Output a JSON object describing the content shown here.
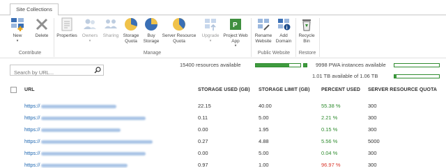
{
  "ribbon": {
    "tab": "Site Collections",
    "groups": [
      {
        "label": "Contribute"
      },
      {
        "label": "Manage"
      },
      {
        "label": "Public Website"
      },
      {
        "label": "Restore"
      }
    ],
    "buttons": {
      "new": "New",
      "delete": "Delete",
      "properties": "Properties",
      "owners": "Owners",
      "sharing": "Sharing",
      "storage_quota": "Storage Quota",
      "buy_storage": "Buy Storage",
      "server_resource_quota": "Server Resource Quota",
      "upgrade": "Upgrade",
      "project_web_app": "Project Web App",
      "rename_website": "Rename Website",
      "add_domain": "Add Domain",
      "recycle_bin": "Recycle Bin"
    }
  },
  "search": {
    "placeholder": "Search by URL..."
  },
  "resources": {
    "resources_text": "15400 resources available",
    "resources_fraction": 0.75,
    "pwa_text": "9998 PWA instances available",
    "pwa_fraction": 0.003,
    "storage_text": "1.01 TB available of 1.06 TB",
    "storage_fraction": 0.02
  },
  "table": {
    "headers": [
      "URL",
      "STORAGE USED (GB)",
      "STORAGE LIMIT (GB)",
      "PERCENT USED",
      "SERVER RESOURCE QUOTA"
    ],
    "rows": [
      {
        "url": "https://",
        "used": "22.15",
        "limit": "40.00",
        "percent": "55.38 %",
        "quota": "300",
        "status": "green"
      },
      {
        "url": "https://",
        "used": "0.11",
        "limit": "5.00",
        "percent": "2.21 %",
        "quota": "300",
        "status": "green"
      },
      {
        "url": "https://",
        "used": "0.00",
        "limit": "1.95",
        "percent": "0.15 %",
        "quota": "300",
        "status": "green"
      },
      {
        "url": "https://",
        "used": "0.27",
        "limit": "4.88",
        "percent": "5.56 %",
        "quota": "5000",
        "status": "green"
      },
      {
        "url": "https://",
        "used": "0.00",
        "limit": "5.00",
        "percent": "0.04 %",
        "quota": "300",
        "status": "green"
      },
      {
        "url": "https://",
        "used": "0.97",
        "limit": "1.00",
        "percent": "96.97 %",
        "quota": "300",
        "status": "red"
      }
    ]
  },
  "colors": {
    "accent_green": "#2e8b2e",
    "warning_red": "#d9372b",
    "link_blue": "#1a64b0"
  }
}
